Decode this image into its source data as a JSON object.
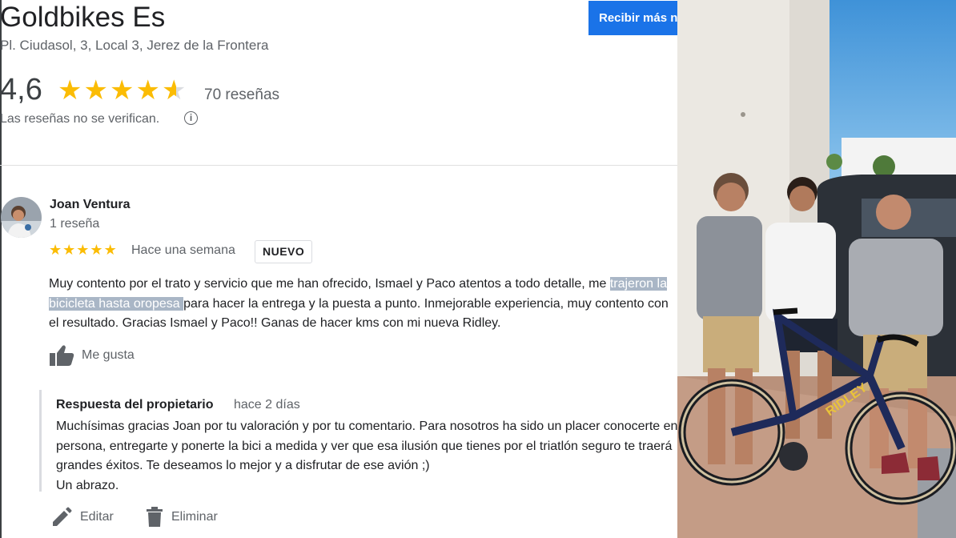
{
  "business": {
    "name": "Goldbikes Es",
    "address": "Pl. Ciudasol, 3, Local 3, Jerez de la Frontera",
    "cta_label": "Recibir más n",
    "rating": "4,6",
    "rating_value": 4.6,
    "review_count": "70 reseñas",
    "unverified_notice": "Las reseñas no se verifican.",
    "info_icon": "info-icon"
  },
  "review": {
    "author": "Joan Ventura",
    "author_reviews": "1 reseña",
    "stars": 5,
    "time": "Hace una semana",
    "badge": "NUEVO",
    "text_before": "Muy contento por el trato y servicio que me han ofrecido, Ismael y Paco atentos a todo detalle, me ",
    "text_highlight": "trajeron la bicicleta hasta oropesa ",
    "text_after": "para hacer la entrega y la puesta a punto. Inmejorable experiencia, muy contento con el resultado. Gracias Ismael y Paco!! Ganas de hacer kms con mi nueva Ridley.",
    "like_label": "Me gusta"
  },
  "owner_reply": {
    "title": "Respuesta del propietario",
    "time": "hace 2 días",
    "text": "Muchísimas gracias Joan por tu valoración y por tu comentario. Para nosotros ha sido un placer conocerte en persona, entregarte y ponerte la bici a medida y ver que esa ilusión que tienes por el triatlón seguro te traerá grandes éxitos. Te deseamos lo mejor y a disfrutar de ese avión ;)",
    "closing": "Un abrazo."
  },
  "actions": {
    "edit_label": "Editar",
    "delete_label": "Eliminar"
  },
  "colors": {
    "star": "#fbbc04",
    "cta": "#1a73e8",
    "highlight": "#a9b6c6"
  }
}
